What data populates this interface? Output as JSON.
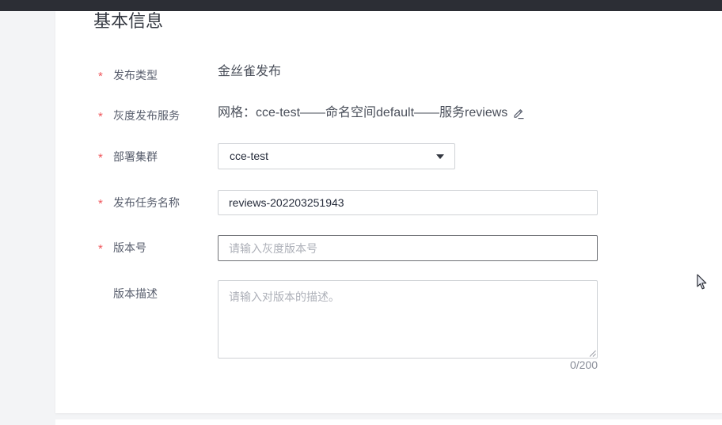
{
  "section": {
    "title": "基本信息"
  },
  "form": {
    "release_type": {
      "required": "*",
      "label": "发布类型",
      "value": "金丝雀发布"
    },
    "gray_service": {
      "required": "*",
      "label": "灰度发布服务",
      "value": "网格：cce-test——命名空间default——服务reviews"
    },
    "cluster": {
      "required": "*",
      "label": "部署集群",
      "value": "cce-test"
    },
    "task_name": {
      "required": "*",
      "label": "发布任务名称",
      "value": "reviews-202203251943"
    },
    "version": {
      "required": "*",
      "label": "版本号",
      "placeholder": "请输入灰度版本号"
    },
    "description": {
      "label": "版本描述",
      "placeholder": "请输入对版本的描述。",
      "counter": "0/200"
    }
  },
  "icons": {
    "edit": "edit-pencil-icon",
    "dropdown": "dropdown-triangle-icon",
    "resize": "resize-grip-icon",
    "cursor": "mouse-cursor-icon"
  },
  "colors": {
    "topbar": "#2c2e35",
    "required_mark": "#f0565b",
    "input_border": "#cfd2d6",
    "input_border_hover": "#6e7075",
    "placeholder": "#adb0b8"
  }
}
